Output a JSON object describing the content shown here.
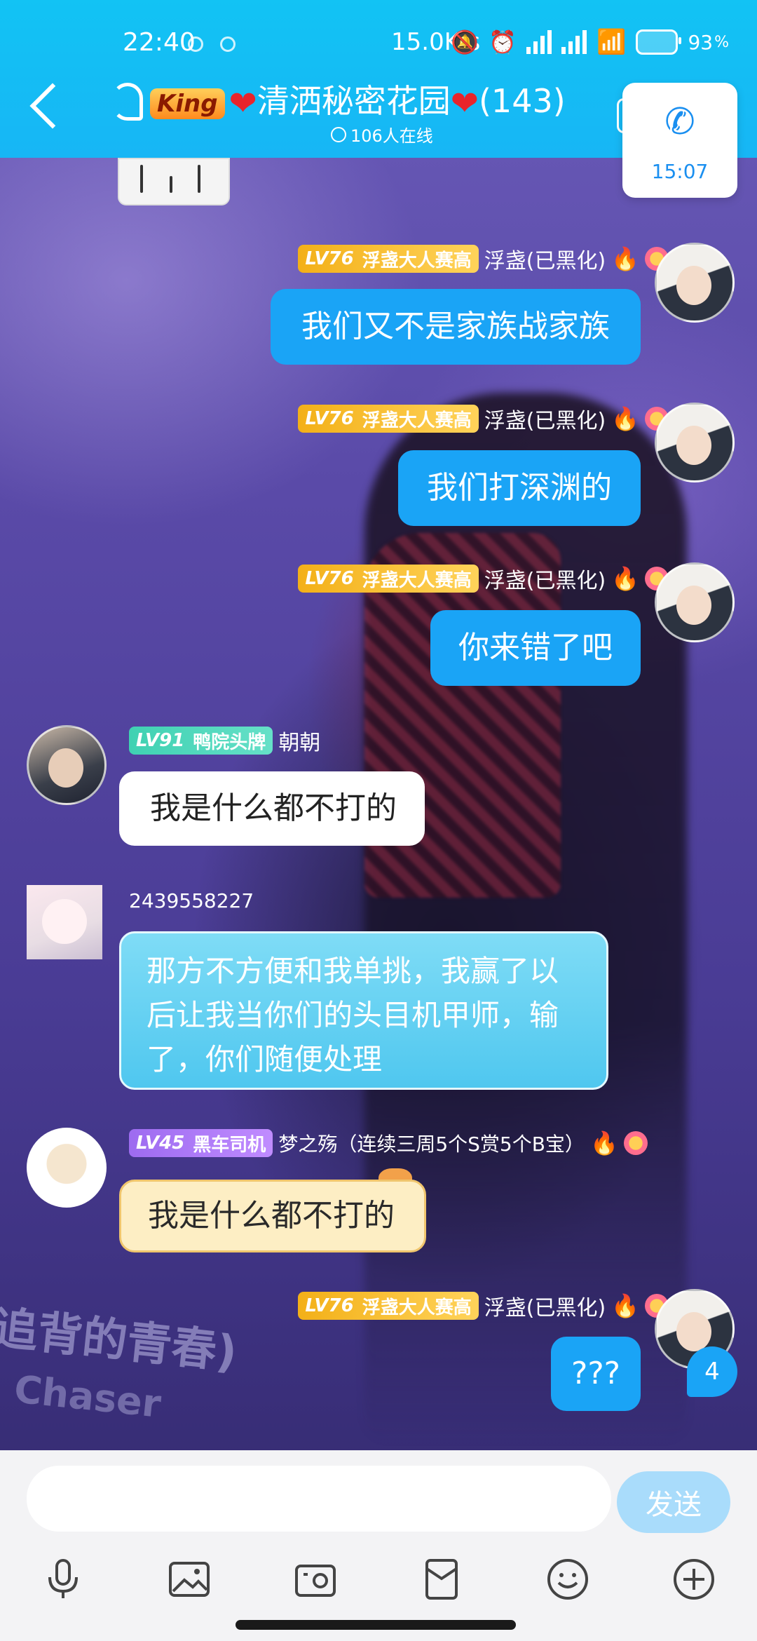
{
  "status_bar": {
    "time": "22:40",
    "net_speed": "15.0K/s",
    "battery": "93"
  },
  "header": {
    "badge": "King",
    "group_name": "清洒秘密花园",
    "member_count": "(143)",
    "online": "106人在线",
    "call_duration": "15:07"
  },
  "messages": [
    {
      "level": "LV76",
      "title": "浮盏大人赛高",
      "nick": "浮盏(已黑化)",
      "text": "我们又不是家族战家族",
      "side": "right"
    },
    {
      "level": "LV76",
      "title": "浮盏大人赛高",
      "nick": "浮盏(已黑化)",
      "text": "我们打深渊的",
      "side": "right"
    },
    {
      "level": "LV76",
      "title": "浮盏大人赛高",
      "nick": "浮盏(已黑化)",
      "text": "你来错了吧",
      "side": "right"
    },
    {
      "level": "LV91",
      "title": "鸭院头牌",
      "nick": "朝朝",
      "text": "我是什么都不打的",
      "side": "left"
    },
    {
      "level": "",
      "title": "",
      "nick": "2439558227",
      "text": "那方不方便和我单挑，我赢了以后让我当你们的头目机甲师，输了，你们随便处理",
      "side": "left"
    },
    {
      "level": "LV45",
      "title": "黑车司机",
      "nick": "梦之殇（连续三周5个S赏5个B宝）",
      "text": "我是什么都不打的",
      "side": "left"
    },
    {
      "level": "LV76",
      "title": "浮盏大人赛高",
      "nick": "浮盏(已黑化)",
      "text": "???",
      "side": "right"
    }
  ],
  "unread_count": "4",
  "input": {
    "placeholder": "",
    "send_label": "发送"
  },
  "toolbar": [
    "microphone-icon",
    "image-icon",
    "camera-icon",
    "red-packet-icon",
    "emoji-icon",
    "plus-icon"
  ],
  "colors": {
    "header": "#17b6f5",
    "bubble_blue": "#1aa4f6",
    "send_disabled": "#a9dcfb"
  }
}
